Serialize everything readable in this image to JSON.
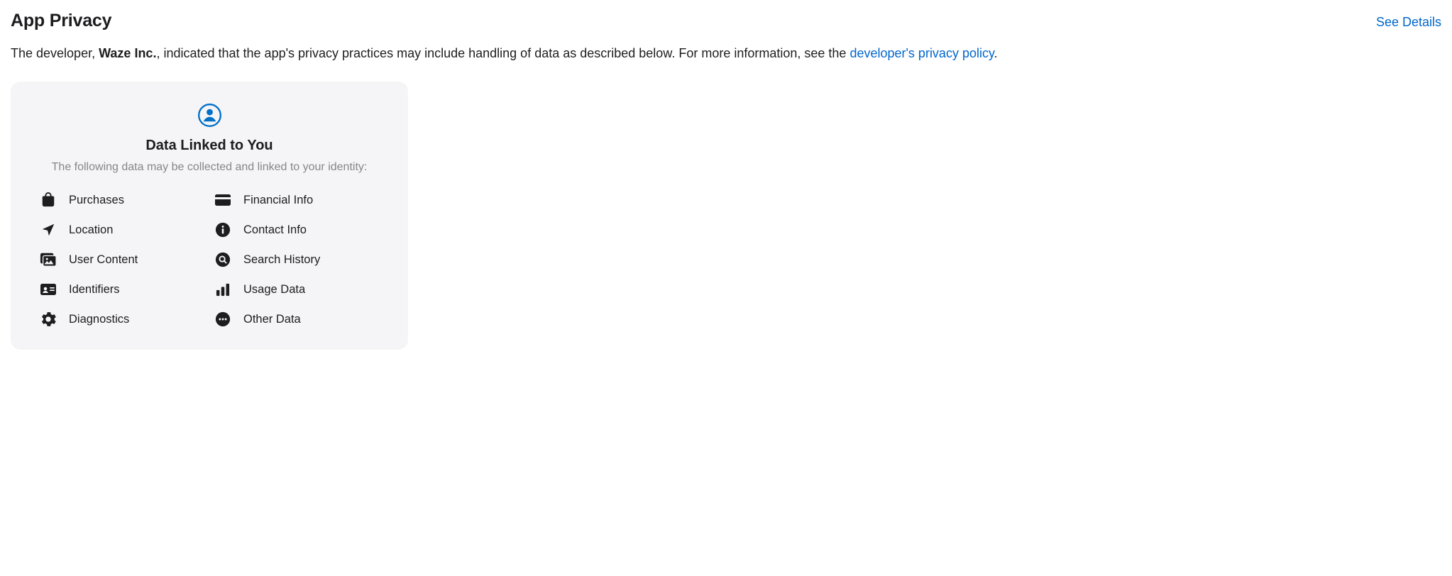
{
  "header": {
    "title": "App Privacy",
    "see_details": "See Details"
  },
  "description": {
    "prefix": "The developer, ",
    "developer": "Waze Inc.",
    "middle": ", indicated that the app's privacy practices may include handling of data as described below. For more information, see the ",
    "link": "developer's privacy policy",
    "suffix": "."
  },
  "card": {
    "title": "Data Linked to You",
    "subtitle": "The following data may be collected and linked to your identity:",
    "items": {
      "purchases": "Purchases",
      "financial": "Financial Info",
      "location": "Location",
      "contact": "Contact Info",
      "user_content": "User Content",
      "search_history": "Search History",
      "identifiers": "Identifiers",
      "usage_data": "Usage Data",
      "diagnostics": "Diagnostics",
      "other_data": "Other Data"
    }
  }
}
